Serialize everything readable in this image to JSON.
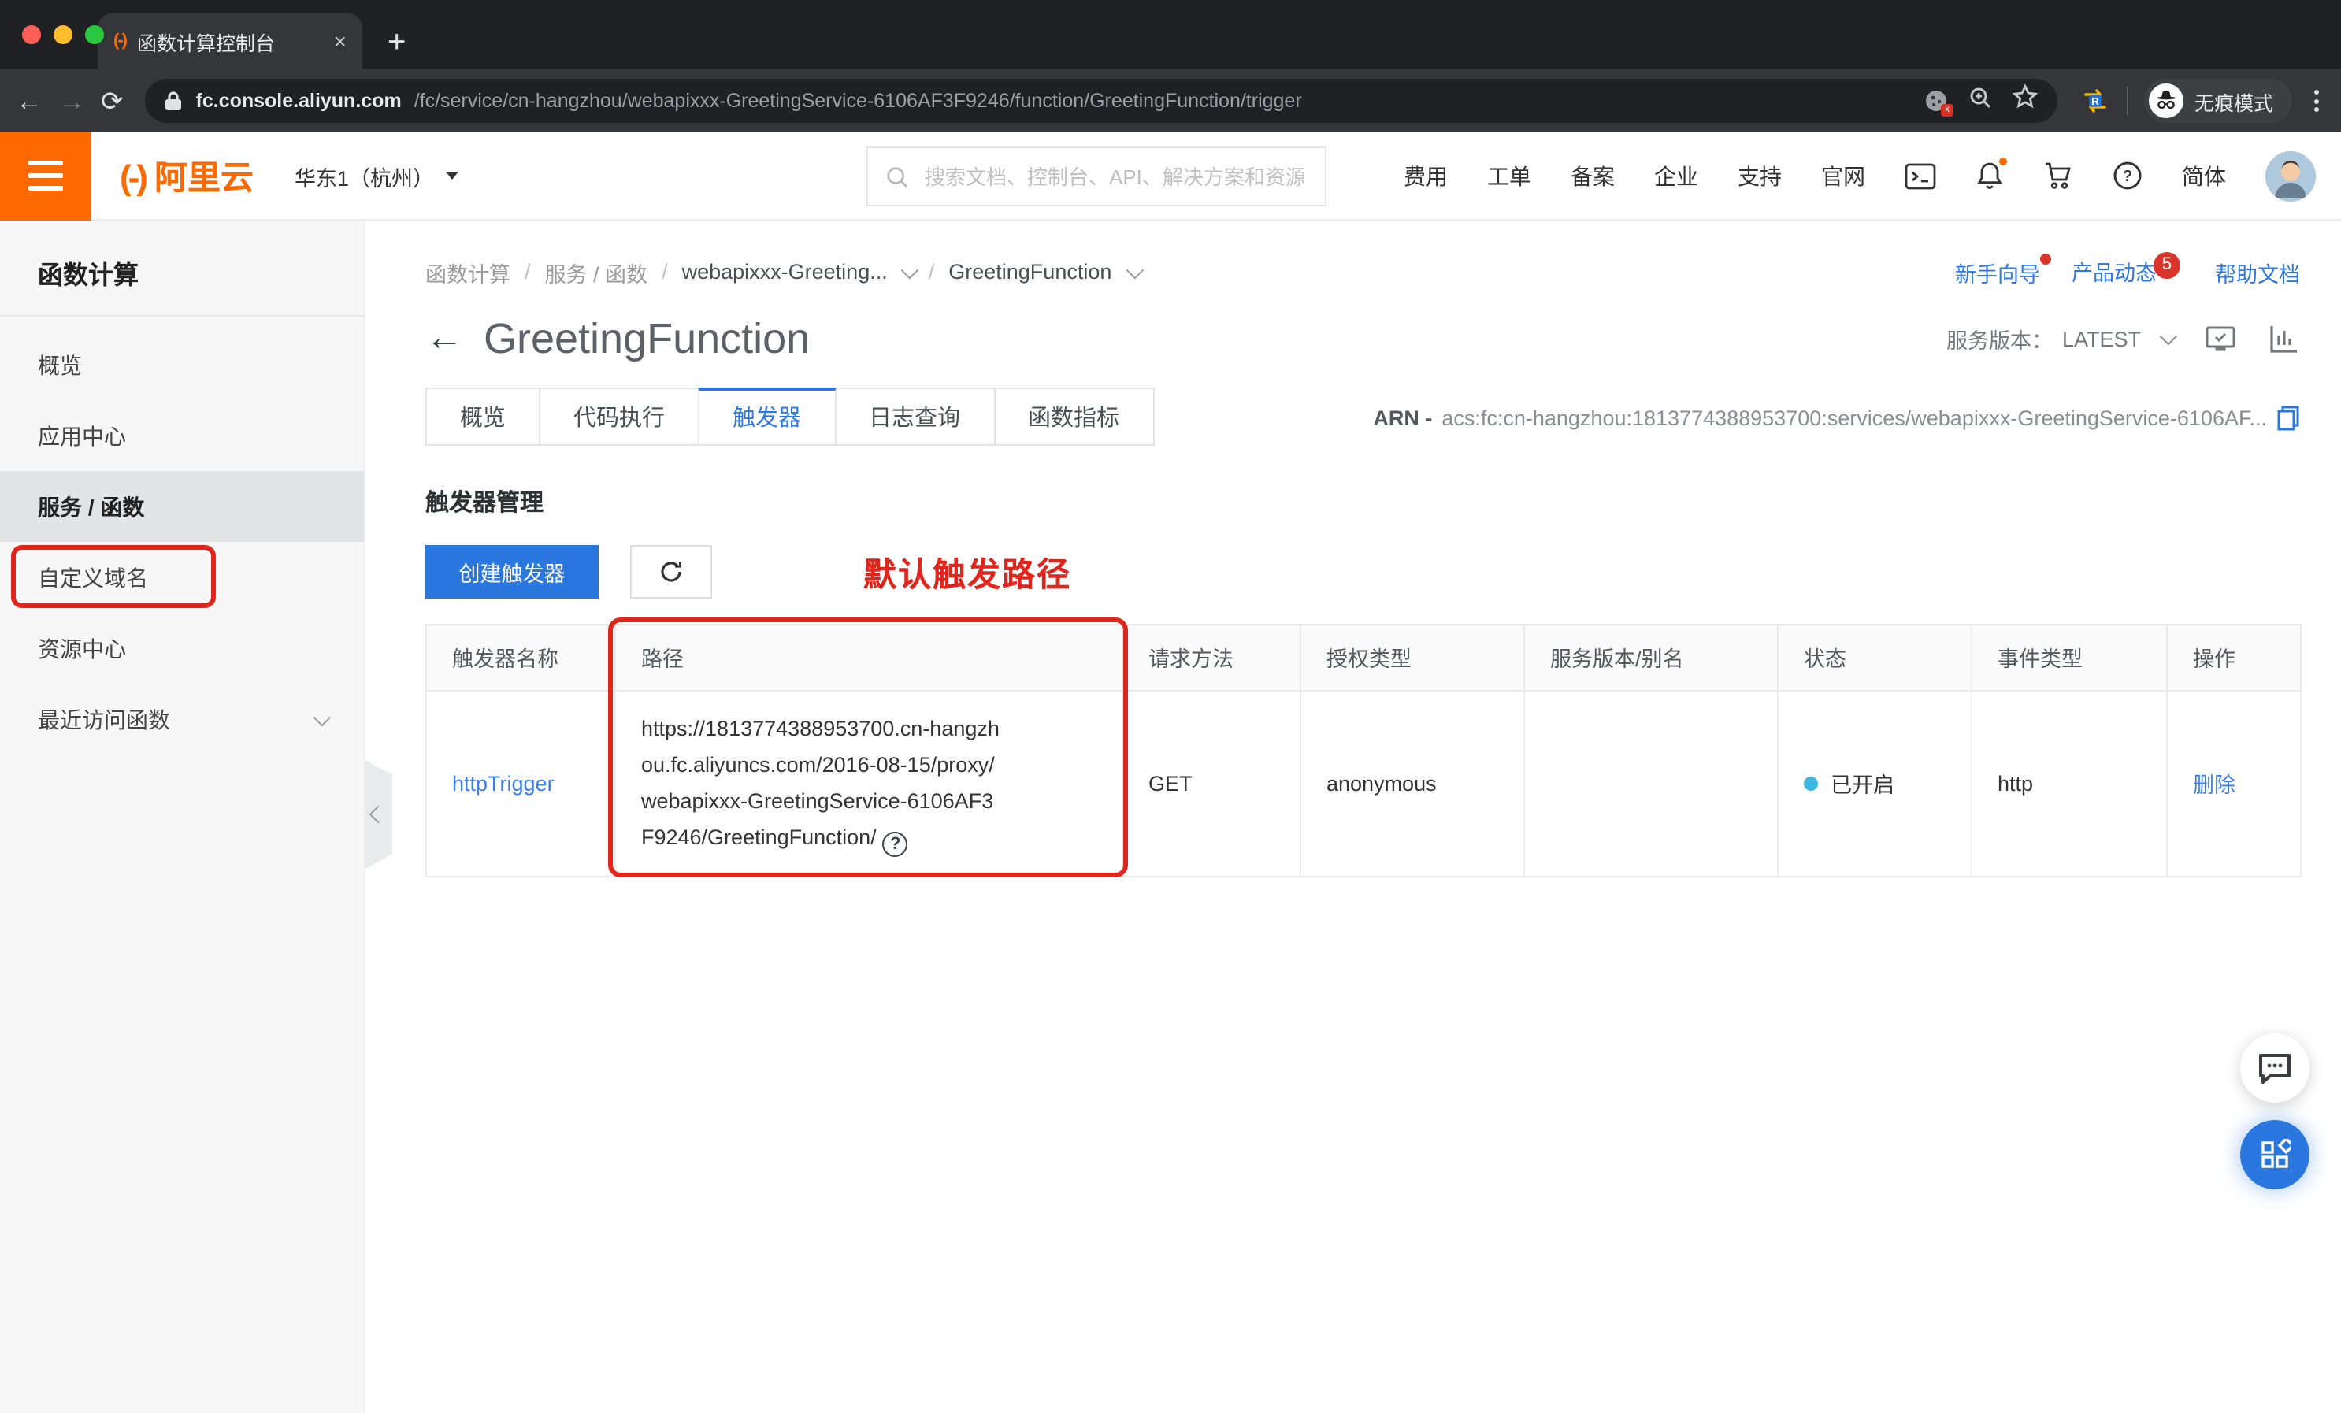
{
  "browser": {
    "tab_title": "函数计算控制台",
    "url_host": "fc.console.aliyun.com",
    "url_path": "/fc/service/cn-hangzhou/webapixxx-GreetingService-6106AF3F9246/function/GreetingFunction/trigger",
    "incognito_label": "无痕模式"
  },
  "icons": {
    "back": "←",
    "forward": "→",
    "reload": "⟳",
    "close": "×",
    "newtab": "+",
    "favicon_mark": "(-)",
    "logo_mark": "(-)",
    "ext_r": "R",
    "terminal": ">_",
    "question": "?",
    "cookie_x": "x",
    "page_back": "←"
  },
  "header": {
    "brand": "阿里云",
    "region": "华东1（杭州）",
    "search_placeholder": "搜索文档、控制台、API、解决方案和资源",
    "nav_items": [
      "费用",
      "工单",
      "备案",
      "企业",
      "支持",
      "官网"
    ],
    "lang": "简体"
  },
  "sidebar": {
    "title": "函数计算",
    "items": [
      "概览",
      "应用中心",
      "服务 / 函数",
      "自定义域名",
      "资源中心",
      "最近访问函数"
    ]
  },
  "breadcrumb": {
    "items": [
      "函数计算",
      "服务 / 函数",
      "webapixxx-Greeting...",
      "GreetingFunction"
    ]
  },
  "quick_links": {
    "guide": "新手向导",
    "updates": "产品动态",
    "updates_badge": "5",
    "docs": "帮助文档"
  },
  "page": {
    "title": "GreetingFunction",
    "version_label": "服务版本：",
    "version": "LATEST",
    "tabs": [
      "概览",
      "代码执行",
      "触发器",
      "日志查询",
      "函数指标"
    ],
    "arn_label": "ARN -",
    "arn_value": "acs:fc:cn-hangzhou:1813774388953700:services/webapixxx-GreetingService-6106AF..."
  },
  "trigger_section": {
    "title": "触发器管理",
    "create_button": "创建触发器",
    "annotation": "默认触发路径"
  },
  "table": {
    "headers": [
      "触发器名称",
      "路径",
      "请求方法",
      "授权类型",
      "服务版本/别名",
      "状态",
      "事件类型",
      "操作"
    ],
    "row": {
      "name": "httpTrigger",
      "path": "https://1813774388953700.cn-hangzhou.fc.aliyuncs.com/2016-08-15/proxy/webapixxx-GreetingService-6106AF3F9246/GreetingFunction/",
      "method": "GET",
      "auth_type": "anonymous",
      "version_alias": "",
      "status": "已开启",
      "event_type": "http",
      "action": "删除"
    }
  },
  "colors": {
    "accent_orange": "#ff6a00",
    "primary_blue": "#2b77e0",
    "annotation_red": "#e0251c",
    "status_dot_blue": "#3fb6e0"
  }
}
